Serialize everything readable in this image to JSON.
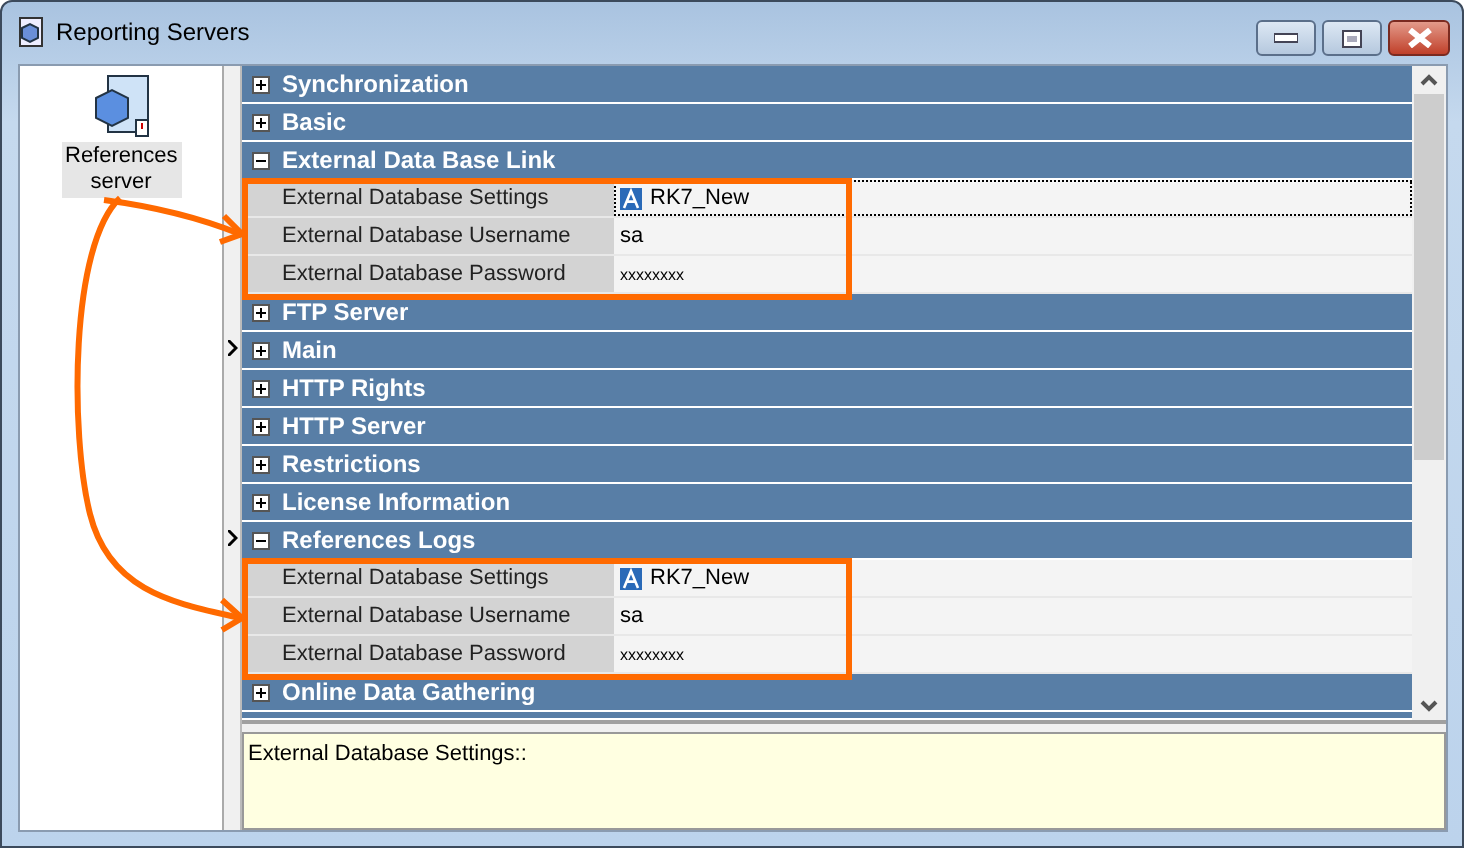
{
  "window": {
    "title": "Reporting Servers"
  },
  "sidebar": {
    "items": [
      {
        "label": "References server",
        "selected": true
      }
    ]
  },
  "grid": {
    "groups": [
      {
        "title": "Synchronization",
        "expanded": false
      },
      {
        "title": "Basic",
        "expanded": false
      },
      {
        "title": "External Data Base Link",
        "expanded": true,
        "highlighted": true,
        "properties": [
          {
            "name": "External Database Settings",
            "value": "RK7_New",
            "kind": "link",
            "selected": true
          },
          {
            "name": "External Database Username",
            "value": "sa",
            "kind": "text",
            "selected": false
          },
          {
            "name": "External Database Password",
            "value": "xxxxxxxx",
            "kind": "secret",
            "selected": false
          }
        ]
      },
      {
        "title": "FTP Server",
        "expanded": false
      },
      {
        "title": "Main",
        "expanded": false
      },
      {
        "title": "HTTP Rights",
        "expanded": false
      },
      {
        "title": "HTTP Server",
        "expanded": false
      },
      {
        "title": "Restrictions",
        "expanded": false
      },
      {
        "title": "License Information",
        "expanded": false
      },
      {
        "title": "References Logs",
        "expanded": true,
        "highlighted": true,
        "properties": [
          {
            "name": "External Database Settings",
            "value": "RK7_New",
            "kind": "link",
            "selected": false
          },
          {
            "name": "External Database Username",
            "value": "sa",
            "kind": "text",
            "selected": false
          },
          {
            "name": "External Database Password",
            "value": "xxxxxxxx",
            "kind": "secret",
            "selected": false
          }
        ]
      },
      {
        "title": "Online Data Gathering",
        "expanded": false
      }
    ]
  },
  "description": {
    "text": "External Database Settings::"
  }
}
